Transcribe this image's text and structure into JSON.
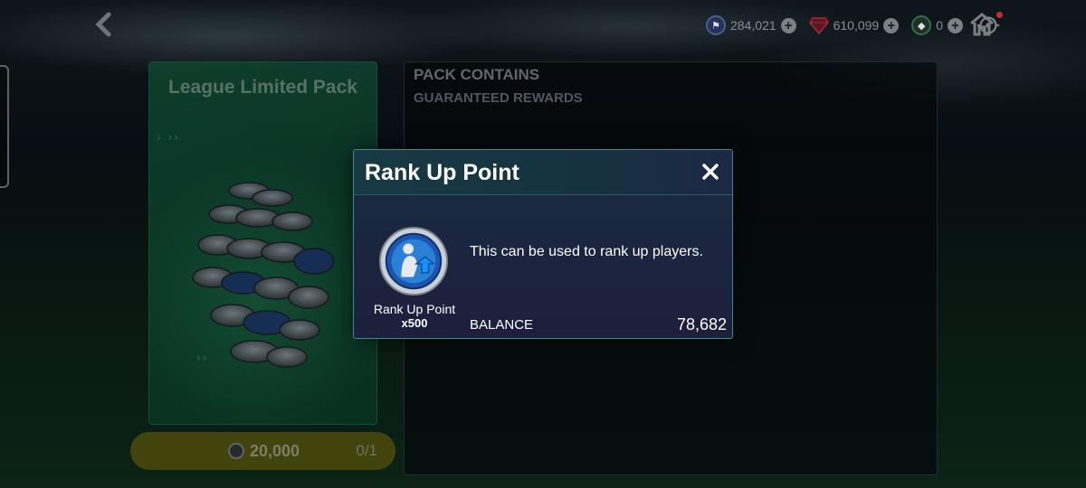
{
  "topbar": {
    "currencies": [
      {
        "icon": "mc-points-icon",
        "value": "284,021"
      },
      {
        "icon": "gem-icon",
        "value": "610,099"
      },
      {
        "icon": "shard-icon",
        "value": "0"
      }
    ]
  },
  "pack": {
    "title": "League Limited Pack",
    "price": "20,000",
    "count": "0/1"
  },
  "contains": {
    "title": "PACK CONTAINS",
    "subtitle": "GUARANTEED REWARDS"
  },
  "modal": {
    "title": "Rank Up Point",
    "close": "✕",
    "item_name": "Rank Up Point",
    "item_qty": "x500",
    "description": "This can be used to rank up players.",
    "balance_label": "BALANCE",
    "balance_value": "78,682"
  },
  "colors": {
    "accent_teal": "#3d8a94",
    "pack_green": "#0e4a33",
    "price_bar": "#4d4d10",
    "rank_blue": "#2a7fd6"
  }
}
